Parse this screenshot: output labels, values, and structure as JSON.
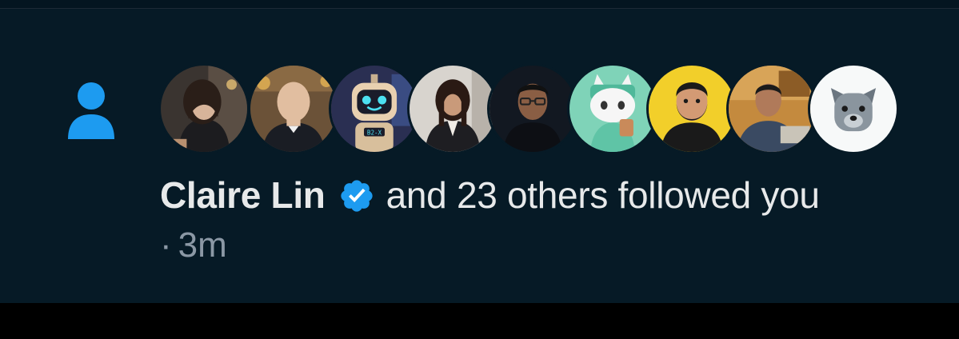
{
  "notification": {
    "type_icon": "person-icon",
    "actor_name": "Claire Lin",
    "actor_verified": true,
    "verified_icon": "verified-badge-icon",
    "action_text": "and 23 others followed you",
    "separator": "·",
    "time_ago": "3m"
  },
  "avatars": [
    {
      "id": "avatar-1",
      "kind": "photo-woman"
    },
    {
      "id": "avatar-2",
      "kind": "photo-man-bald"
    },
    {
      "id": "avatar-3",
      "kind": "robot-illustration"
    },
    {
      "id": "avatar-4",
      "kind": "photo-woman-blazer"
    },
    {
      "id": "avatar-5",
      "kind": "photo-man-glasses"
    },
    {
      "id": "avatar-6",
      "kind": "cat-illustration"
    },
    {
      "id": "avatar-7",
      "kind": "bearded-man-illustration"
    },
    {
      "id": "avatar-8",
      "kind": "photo-man-laptop"
    },
    {
      "id": "avatar-9",
      "kind": "dog-icon"
    }
  ],
  "colors": {
    "background": "#061a26",
    "text_primary": "#e7e9ea",
    "text_secondary": "#8b98a5",
    "accent": "#1d9bf0"
  }
}
